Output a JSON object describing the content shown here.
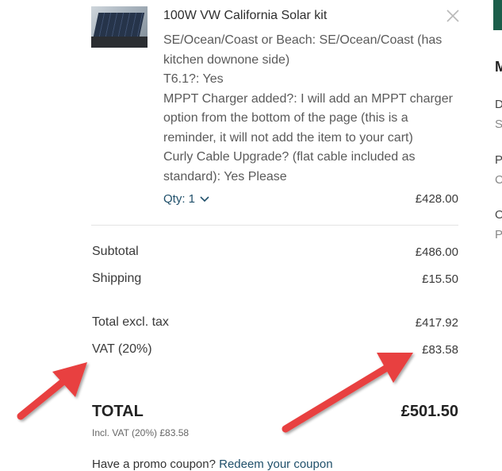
{
  "item": {
    "title": "100W VW California Solar kit",
    "options": [
      "SE/Ocean/Coast or Beach: SE/Ocean/Coast (has",
      "kitchen downone side)",
      "T6.1?: Yes",
      "MPPT Charger added?: I will add an MPPT charger",
      "option from the bottom of the page (this is a",
      "reminder, it will not add the item to your cart)",
      "Curly Cable Upgrade? (flat cable included as",
      "standard): Yes Please"
    ],
    "qty_label": "Qty: 1",
    "price": "£428.00"
  },
  "summary": {
    "subtotal_label": "Subtotal",
    "subtotal_value": "£486.00",
    "shipping_label": "Shipping",
    "shipping_value": "£15.50",
    "excl_label": "Total excl. tax",
    "excl_value": "£417.92",
    "vat_label": "VAT (20%)",
    "vat_value": "£83.58",
    "total_label": "TOTAL",
    "total_value": "£501.50",
    "incl_vat": "Incl. VAT (20%) £83.58"
  },
  "promo": {
    "text": "Have a promo coupon? ",
    "link": "Redeem your coupon"
  },
  "right_column": {
    "heading": "M",
    "letters": [
      "D",
      "S",
      "P",
      "C",
      "O",
      "P"
    ]
  },
  "colors": {
    "link": "#1f4f6a",
    "accent_bar": "#1b5e4a",
    "arrow": "#e8403f"
  }
}
